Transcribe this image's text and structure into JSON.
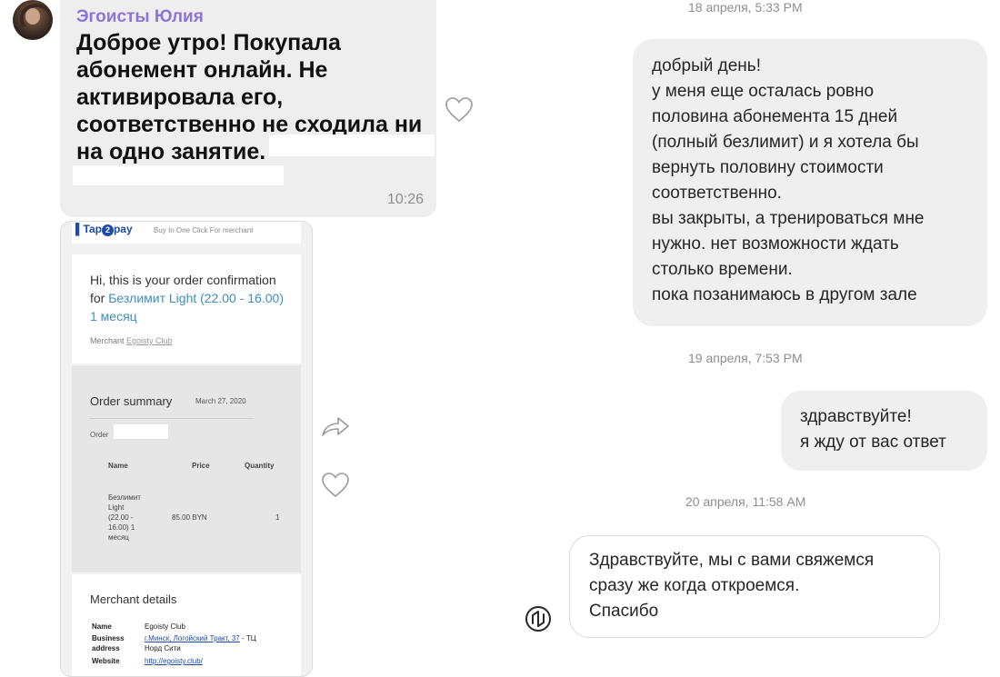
{
  "chat": {
    "sender_name": "Эгоисты Юлия",
    "message_text": "Доброе утро! Покупала\nабонемент онлайн. Не\nактивировала его,\nсоответственно не сходила ни\nна одно занятие.",
    "message_time": "10:26"
  },
  "receipt": {
    "logo_prefix": "Tap",
    "logo_two": "2",
    "logo_suffix": "pay",
    "tagline": "Buy In One Click For merchant",
    "hi_prefix": "Hi, this is your order confirmation for ",
    "hi_link": "Безлимит Light (22.00 - 16.00) 1 месяц",
    "merchant_label": "Merchant",
    "merchant_link": "Egoisty Club",
    "summary_title": "Order summary",
    "summary_date": "March 27, 2020",
    "order_label": "Order",
    "col_name": "Name",
    "col_price": "Price",
    "col_quantity": "Quantity",
    "item_name": "Безлимит\nLight\n(22.00 -\n16.00) 1\nмесяц",
    "item_price": "85.00 BYN",
    "item_qty": "1",
    "details_title": "Merchant details",
    "details_name_label": "Name",
    "details_name_value": "Egoisty Club",
    "details_address_label": "Business\naddress",
    "details_address_link": "г.Минск, Логойский Тракт, 37",
    "details_address_tail": " - ТЦ\nНорд Сити",
    "details_website_label": "Website",
    "details_website_value": "http://egoisty.club/"
  },
  "thread": {
    "ts1": "18 апреля, 5:33 PM",
    "msg1": "добрый день!\nу меня еще осталась ровно\nполовина абонемента 15 дней\n(полный безлимит) и я хотела бы\nвернуть половину стоимости\nсоответственно.\nвы закрыты, а тренироваться мне\nнужно. нет возможности ждать\nстолько времени.\nпока позанимаюсь в другом зале",
    "ts2": "19 апреля, 7:53 PM",
    "msg2": "здравствуйте!\nя жду от вас ответ",
    "ts3": "20 апреля, 11:58 AM",
    "msg3": "Здравствуйте, мы с вами свяжемся\nсразу же когда откроемся.\nСпасибо"
  },
  "icons": [
    "heart-icon",
    "share-icon",
    "heart-icon",
    "verified-badge-icon",
    "avatar"
  ]
}
